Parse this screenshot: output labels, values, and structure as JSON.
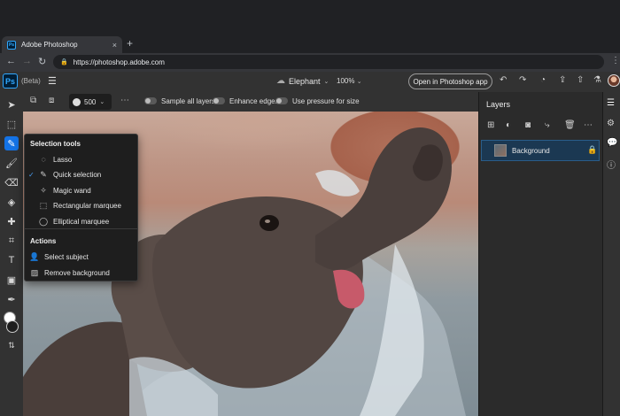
{
  "browser": {
    "tab_title": "Adobe Photoshop",
    "tab_favicon": "Ps",
    "tab_close": "×",
    "new_tab": "+",
    "url": "https://photoshop.adobe.com",
    "nav": {
      "back": "←",
      "forward": "→",
      "reload": "↻"
    },
    "menu": "⋮"
  },
  "app": {
    "logo": "Ps",
    "beta_label": "(Beta)",
    "document_title": "Elephant",
    "zoom": "100%",
    "open_in_app_label": "Open in Photoshop app",
    "header_icons": [
      "undo-icon",
      "redo-icon",
      "comment-icon",
      "share-icon",
      "export-icon",
      "labs-icon"
    ]
  },
  "options": {
    "brush_size": "500",
    "sample_all_layers": "Sample all layers",
    "enhance_edges": "Enhance edges",
    "use_pressure": "Use pressure for size"
  },
  "flyout": {
    "selection_header": "Selection tools",
    "selection_items": [
      {
        "label": "Lasso",
        "icon": "lasso-icon",
        "checked": false
      },
      {
        "label": "Quick selection",
        "icon": "quick-selection-icon",
        "checked": true
      },
      {
        "label": "Magic wand",
        "icon": "magic-wand-icon",
        "checked": false
      },
      {
        "label": "Rectangular marquee",
        "icon": "rect-marquee-icon",
        "checked": false
      },
      {
        "label": "Elliptical marquee",
        "icon": "ellipse-marquee-icon",
        "checked": false
      }
    ],
    "actions_header": "Actions",
    "action_items": [
      {
        "label": "Select subject",
        "icon": "person-icon"
      },
      {
        "label": "Remove background",
        "icon": "image-icon"
      }
    ],
    "checkmark": "✓"
  },
  "layers": {
    "title": "Layers",
    "layer_name": "Background",
    "locked": true
  },
  "colors": {
    "accent": "#1473e6",
    "selected_layer_bg": "#1b3852",
    "panel_bg": "#2b2b2b",
    "toolbar_bg": "#323232"
  }
}
